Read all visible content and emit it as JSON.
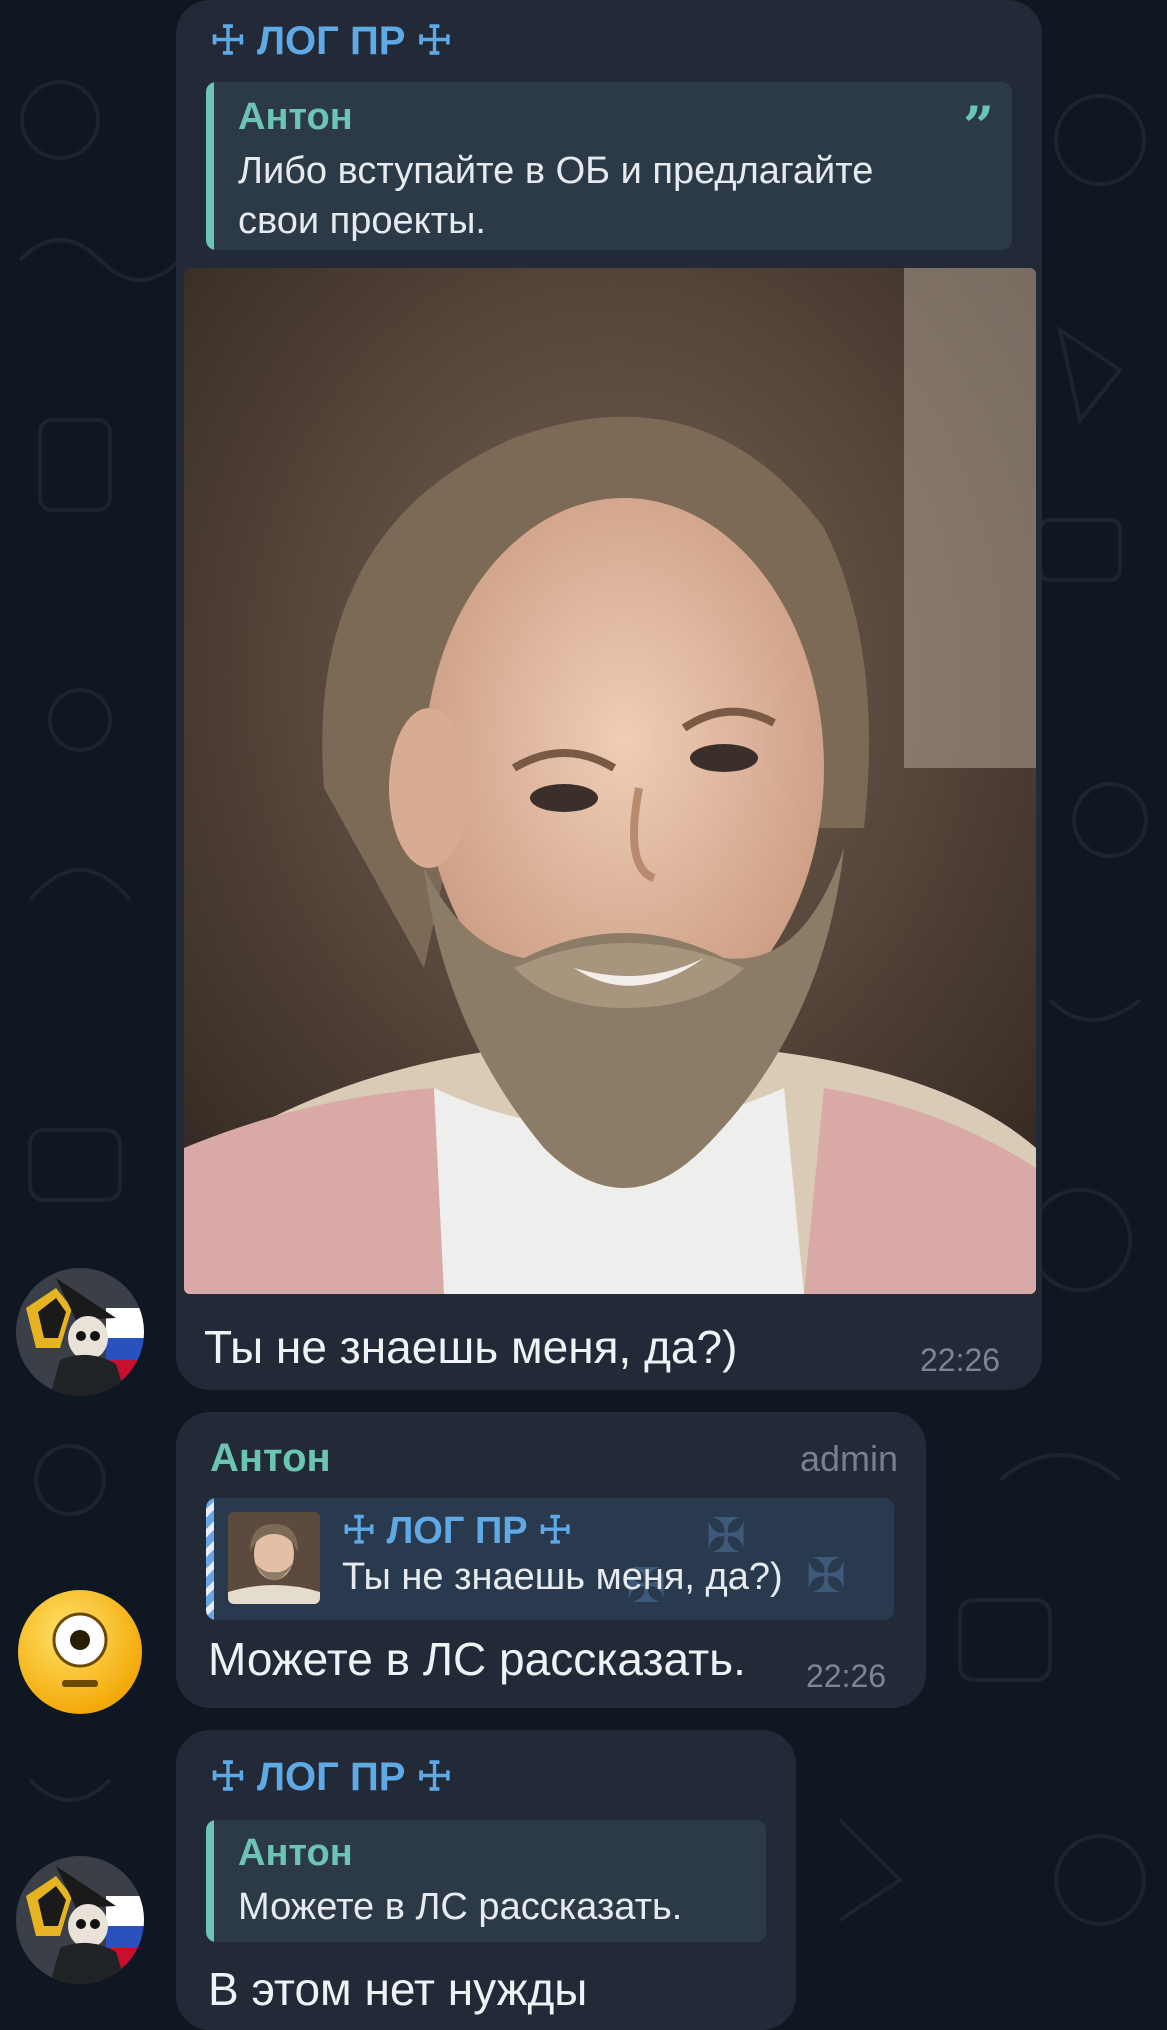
{
  "messages": [
    {
      "sender": "☩ ЛОГ ПР ☩",
      "quote": {
        "author": "Антон",
        "lines": [
          "Либо вступайте в ОБ и предлагайте",
          "свои проекты."
        ]
      },
      "photo": "bearded-man-photo",
      "text": "Ты не знаешь меня, да?)",
      "time": "22:26"
    },
    {
      "sender": "Антон",
      "role": "admin",
      "reply": {
        "author": "☩ ЛОГ ПР ☩",
        "text": "Ты не знаешь меня, да?)"
      },
      "text": "Можете в ЛС рассказать.",
      "time": "22:26"
    },
    {
      "sender": "☩ ЛОГ ПР ☩",
      "quote": {
        "author": "Антон",
        "lines": [
          "Можете в ЛС рассказать."
        ]
      },
      "text": "В этом нет нужды"
    }
  ],
  "colors": {
    "background": "#0f1722",
    "bubble": "#212a36",
    "sender_blue": "#5fa9e6",
    "accent_teal": "#6cc4b5"
  }
}
